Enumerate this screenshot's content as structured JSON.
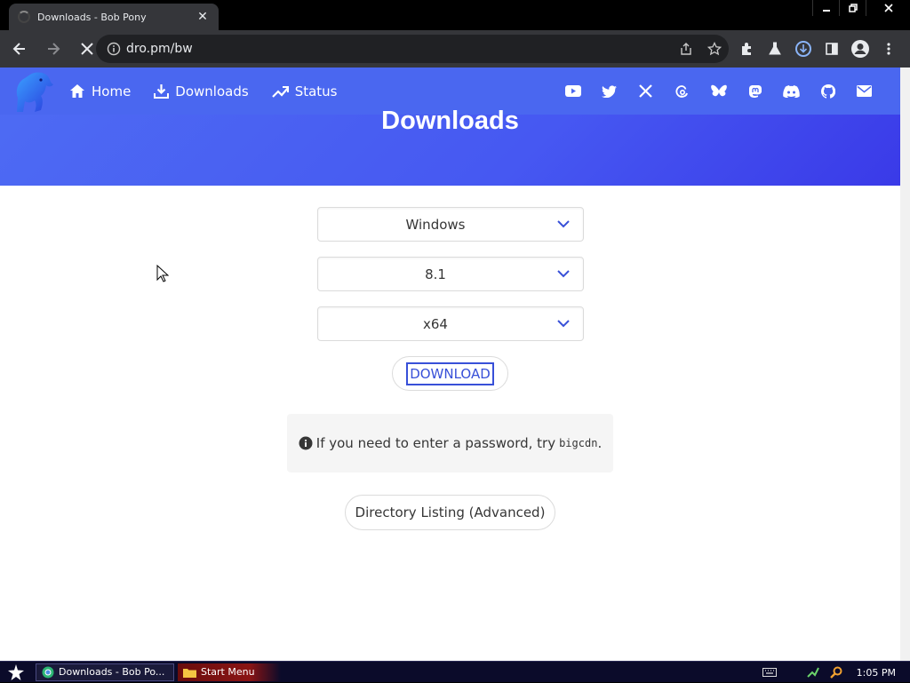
{
  "browser": {
    "tab_title": "Downloads - Bob Pony",
    "tab_close": "✕",
    "url": "dro.pm/bw"
  },
  "site": {
    "nav": [
      {
        "label": "Home",
        "icon": "home-icon"
      },
      {
        "label": "Downloads",
        "icon": "download-icon"
      },
      {
        "label": "Status",
        "icon": "trend-icon"
      }
    ],
    "social_icons": [
      "youtube-icon",
      "twitter-icon",
      "x-icon",
      "threads-icon",
      "bluesky-icon",
      "mastodon-icon",
      "discord-icon",
      "github-icon",
      "email-icon"
    ],
    "page_title": "Downloads"
  },
  "form": {
    "os": "Windows",
    "version": "8.1",
    "arch": "x64",
    "download_label": "DOWNLOAD"
  },
  "notice": {
    "text": "If you need to enter a password, try",
    "code": "bigcdn",
    "suffix": "."
  },
  "directory_button": "Directory Listing (Advanced)",
  "taskbar": {
    "items": [
      {
        "label": "Downloads - Bob Po...",
        "icon": "chrome-icon"
      },
      {
        "label": "Start Menu",
        "icon": "folder-icon"
      }
    ],
    "clock": "1:05 PM"
  },
  "colors": {
    "brand": "#4a67f0",
    "accent": "#3850d8"
  }
}
